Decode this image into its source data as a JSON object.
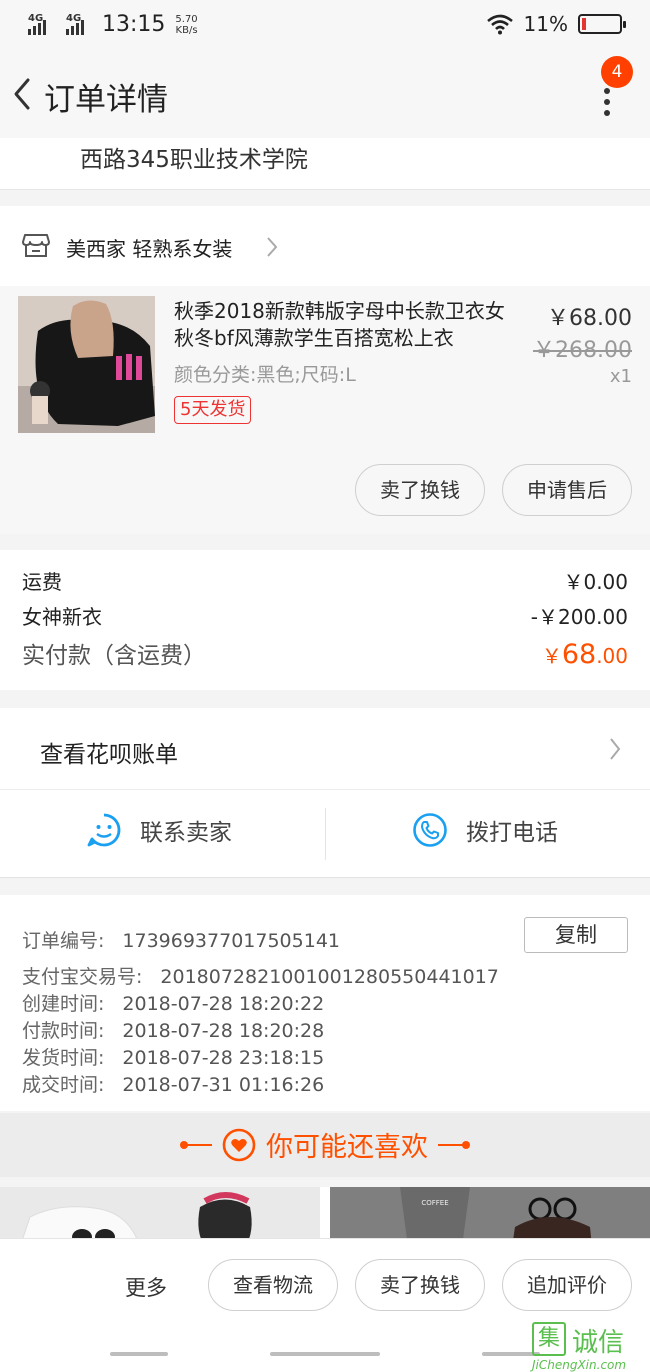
{
  "status_bar": {
    "network_1": "4G",
    "network_2": "4G",
    "time": "13:15",
    "speed_value": "5.70",
    "speed_unit": "KB/s",
    "battery_percent": "11%",
    "battery_level": 0.11,
    "battery_color": "#e33333"
  },
  "nav": {
    "title": "订单详情",
    "badge_count": "4",
    "badge_color": "#ff4000"
  },
  "address": {
    "line": "西路345职业技术学院"
  },
  "shop": {
    "name": "美西家 轻熟系女装"
  },
  "product": {
    "title": "秋季2018新款韩版字母中长款卫衣女秋冬bf风薄款学生百搭宽松上衣",
    "sku": "颜色分类:黑色;尺码:L",
    "shipping_tag": "5天发货",
    "price": "￥68.00",
    "original_price": "￥268.00",
    "quantity": "x1",
    "actions": [
      "卖了换钱",
      "申请售后"
    ]
  },
  "totals": {
    "shipping_label": "运费",
    "shipping_value": "￥0.00",
    "discount_label": "女神新衣",
    "discount_value": "-￥200.00",
    "paid_label": "实付款（含运费）",
    "paid_currency": "￥",
    "paid_int": "68",
    "paid_dec": ".00",
    "accent_color": "#ff5000"
  },
  "huabei": {
    "label": "查看花呗账单"
  },
  "contact": {
    "seller_label": "联系卖家",
    "phone_label": "拨打电话",
    "icon_color": "#1aa0f0"
  },
  "order_info": {
    "copy_label": "复制",
    "rows": [
      {
        "key": "订单编号:",
        "value": "173969377017505141"
      },
      {
        "key": "支付宝交易号:",
        "value": "2018072821001001280550441017"
      },
      {
        "key": "创建时间:",
        "value": "2018-07-28 18:20:22"
      },
      {
        "key": "付款时间:",
        "value": "2018-07-28 18:20:28"
      },
      {
        "key": "发货时间:",
        "value": "2018-07-28 23:18:15"
      },
      {
        "key": "成交时间:",
        "value": "2018-07-31 01:16:26"
      }
    ]
  },
  "recommend": {
    "title": "你可能还喜欢"
  },
  "bottom_bar": {
    "more_label": "更多",
    "buttons": [
      "查看物流",
      "卖了换钱",
      "追加评价"
    ]
  },
  "watermark": {
    "glyph": "集",
    "text": "诚信",
    "url": "JiChengXin.com"
  }
}
